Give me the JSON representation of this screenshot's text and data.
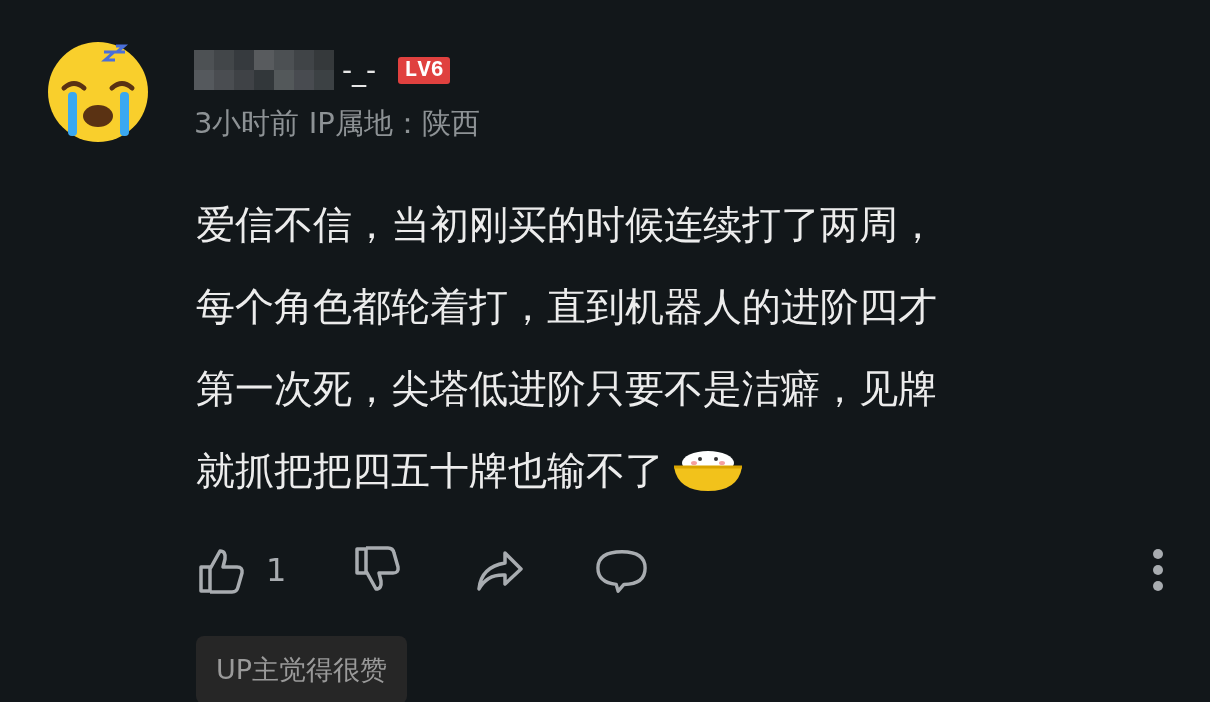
{
  "comment": {
    "username_visible": "-_-",
    "level_badge": "LV6",
    "meta": "3小时前 IP属地：陕西",
    "body_lines": [
      "爱信不信，当初刚买的时候连续打了两周，",
      "每个角色都轮着打，直到机器人的进阶四才",
      "第一次死，尖塔低进阶只要不是洁癖，见牌",
      "就抓把把四五十牌也输不了"
    ],
    "like_count": "1",
    "liked": false,
    "tag": "UP主觉得很赞"
  }
}
